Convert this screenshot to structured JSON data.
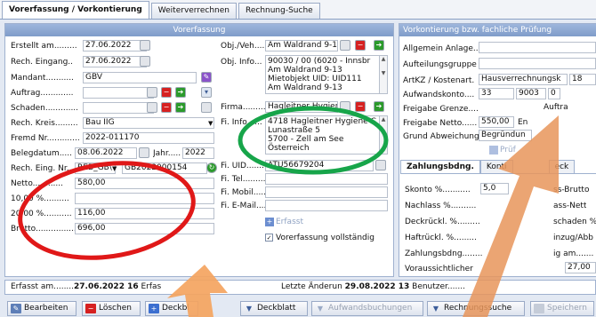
{
  "tabs": [
    "Vorerfassung / Vorkontierung",
    "Weiterverrechnen",
    "Rechnung-Suche"
  ],
  "left_panel": {
    "title": "Vorerfassung",
    "fields": {
      "erstellt_label": "Erstellt am.........",
      "erstellt_value": "27.06.2022",
      "rech_eingang_label": "Rech. Eingang..",
      "rech_eingang_value": "27.06.2022",
      "mandant_label": "Mandant...........",
      "mandant_value": "GBV",
      "auftrag_label": "Auftrag.............",
      "auftrag_value": "",
      "schaden_label": "Schaden.............",
      "schaden_value": "",
      "rech_kreis_label": "Rech. Kreis.........",
      "rech_kreis_value": "Bau IIG",
      "fremd_nr_label": "Fremd Nr.............",
      "fremd_nr_value": "2022-011170",
      "belegdatum_label": "Belegdatum.....",
      "belegdatum_value": "08.06.2022",
      "jahr_label": "Jahr.....",
      "jahr_value": "2022",
      "rech_eing_nr_label": "Rech. Eing. Nr..",
      "rech_eing_nr_select": "REB_GB\\",
      "rech_eing_nr_value": "GB2022000154",
      "netto_label": "Netto............",
      "netto_value": "580,00",
      "ust10_label": "10,00 %..........",
      "ust10_value": "",
      "ust20_label": "20,00 %...........",
      "ust20_value": "116,00",
      "brutto_label": "Brutto................",
      "brutto_value": "696,00"
    },
    "obj": {
      "obj_veh_label": "Obj./Veh....",
      "obj_veh_value": "Am Waldrand 9-1:",
      "obj_info_label": "Obj. Info...",
      "obj_info_value": "90030 / 00 (6020 - Innsbr\nAm Waldrand 9-13\nMietobjekt UID: UID111\nAm Waldrand 9-13",
      "firma_label": "Firma.........",
      "firma_value": "Hagleitner Hygiene",
      "fi_info_label": "Fi. Info......",
      "fi_info_value": "4718 Hagleitner Hygiene C\nLunastraße 5\n5700 - Zell am See\nÖsterreich",
      "fi_uid_label": "Fi. UID.........",
      "fi_uid_value": "ATU56679204",
      "fi_tel_label": "Fi. Tel.........",
      "fi_mobil_label": "Fi. Mobil......",
      "fi_email_label": "Fi. E-Mail....",
      "erfasst_button": "Erfasst",
      "vollstaendig_label": "Vorerfassung vollständig"
    }
  },
  "right_panel": {
    "title": "Vorkontierung bzw. fachliche Prüfung",
    "fields": {
      "allgemein_label": "Allgemein Anlage..",
      "aufteilung_label": "Aufteilungsgruppe",
      "artkz_label": "ArtKZ / Kostenart.",
      "artkz_value": "Hausverrechnungsk",
      "artkz_value2": "18",
      "aufwandskonto_label": "Aufwandskonto....",
      "aufwandskonto_v1": "33",
      "aufwandskonto_v2": "9003",
      "aufwandskonto_v3": "0",
      "freigabe_grenze_label": "Freigabe Grenze....",
      "freigabe_grenze_value": "Auftra",
      "freigabe_netto_label": "Freigabe Netto......",
      "freigabe_netto_value": "550,00",
      "freigabe_netto_value2": "En",
      "grund_label": "Grund Abweichung",
      "grund_value": "Begründun",
      "pruef_button": "Prüf"
    },
    "subtabs": [
      "Zahlungsbdng.",
      "Konti",
      "eck"
    ],
    "zahlung": {
      "skonto_label": "Skonto %...........",
      "skonto_value": "5,0",
      "skonto_right": "ss-Brutto",
      "nachlass_label": "Nachlass %..........",
      "nachlass_right": "ass-Nett",
      "deckrueckl_label": "Deckrückl. %.........",
      "deckrueckl_right": "schaden %",
      "haftrueckl_label": "Haftrückl. %.........",
      "haftrueckl_right": "inzug/Abb",
      "zahlungsbdng_label": "Zahlungsbdng........",
      "zahlungsbdng_right": "ig am.......",
      "voraussichtlich_label": "Voraussichtlicher",
      "voraussichtlich_right": "27,00"
    }
  },
  "status_bar": {
    "erfasst_prefix": "Erfasst am........",
    "erfasst_date": "27.06.2022 16",
    "erfasst_suffix": "Erfas",
    "letzte_prefix": "Letzte Änderun",
    "letzte_date": "29.08.2022 13",
    "letzte_suffix": "Benutzer......."
  },
  "toolbar": {
    "bearbeiten": "Bearbeiten",
    "loeschen": "Löschen",
    "deckblatt1": "Deckbl",
    "deckblatt2": "Deckblatt",
    "aufwandsbuchungen": "Aufwandsbuchungen",
    "rechnungssuche": "Rechnungssuche",
    "speichern": "Speichern"
  },
  "colors": {
    "annotation_red": "#e01818",
    "annotation_green": "#17a54a",
    "annotation_arrow": "#f4a460"
  }
}
